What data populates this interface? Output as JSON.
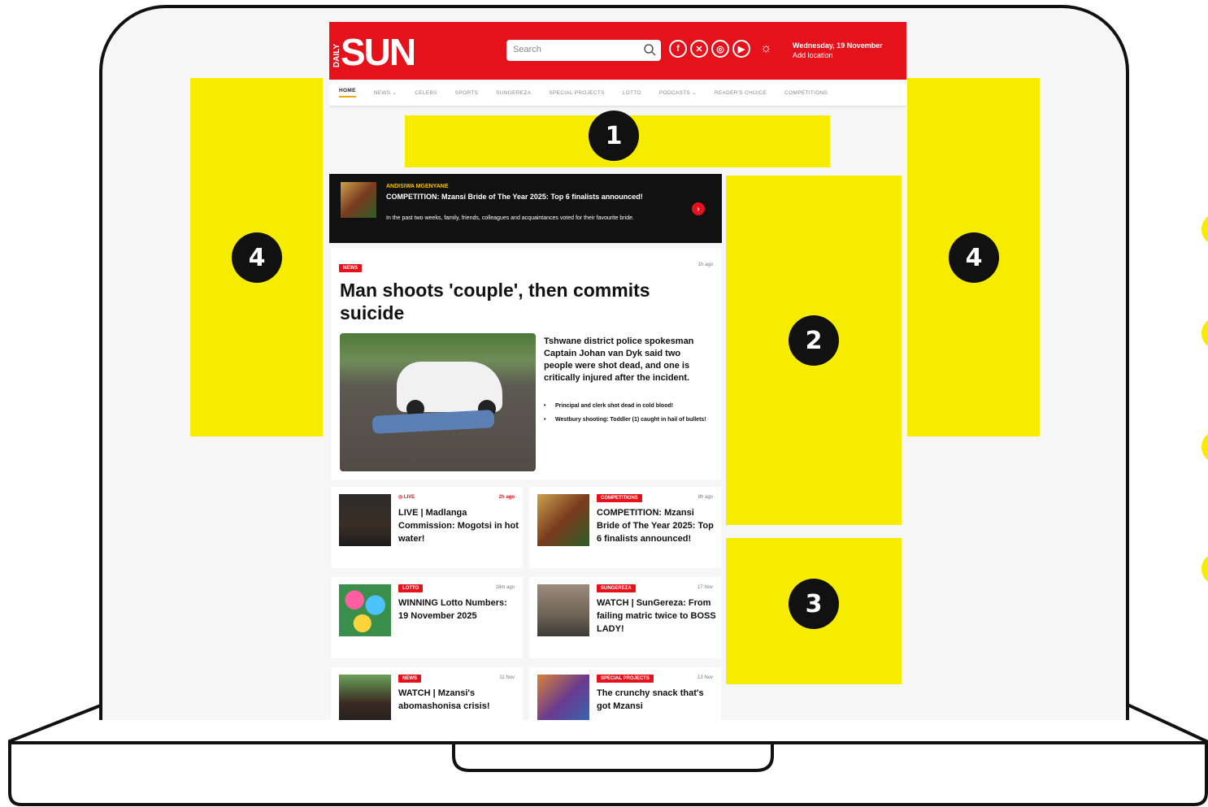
{
  "site": {
    "logo_daily": "DAILY",
    "logo_sun": "SUN",
    "search_placeholder": "Search",
    "date": "Wednesday, 19 November",
    "location": "Add location"
  },
  "nav": [
    "HOME",
    "NEWS ⌄",
    "CELEBS",
    "SPORTS",
    "SUNGEREZA",
    "SPECIAL PROJECTS",
    "LOTTO",
    "PODCASTS ⌄",
    "READER'S CHOICE",
    "COMPETITIONS"
  ],
  "promo": {
    "kicker": "ANDISIWA MGENYANE",
    "title": "COMPETITION: Mzansi Bride of The Year 2025: Top 6 finalists announced!",
    "desc": "In the past two weeks, family, friends, colleagues and acquaintances voted for their favourite bride."
  },
  "main": {
    "tag": "NEWS",
    "time": "1h ago",
    "headline": "Man shoots 'couple', then commits suicide",
    "summary": "Tshwane district police spokesman Captain Johan van Dyk said two people were shot dead, and one is critically injured after the incident.",
    "bullets": [
      "Principal and clerk shot dead in cold blood!",
      "Westbury shooting: Toddler (1) caught in hail of bullets!"
    ]
  },
  "cards": [
    {
      "tag": "◎ LIVE",
      "time": "2h ago",
      "title": "LIVE | Madlanga Commission: Mogotsi in hot water!"
    },
    {
      "tag": "COMPETITIONS",
      "time": "8h ago",
      "title": "COMPETITION: Mzansi Bride of The Year 2025: Top 6 finalists announced!"
    },
    {
      "tag": "LOTTO",
      "time": "18m ago",
      "title": "WINNING Lotto Numbers: 19 November 2025"
    },
    {
      "tag": "SUNGEREZA",
      "time": "17 Nov",
      "title": "WATCH | SunGereza: From failing matric twice to BOSS LADY!"
    },
    {
      "tag": "NEWS",
      "time": "11 Nov",
      "title": "WATCH | Mzansi's abomashonisa crisis!"
    },
    {
      "tag": "SPECIAL PROJECTS",
      "time": "13 Nov",
      "title": "The crunchy snack that's got Mzansi"
    }
  ],
  "badges": {
    "b1": "1",
    "b2": "2",
    "b3": "3",
    "b4": "4"
  },
  "colors": {
    "brand_red": "#e5121c",
    "ad_yellow": "#f6ec00",
    "nav_active": "#f0a800"
  }
}
